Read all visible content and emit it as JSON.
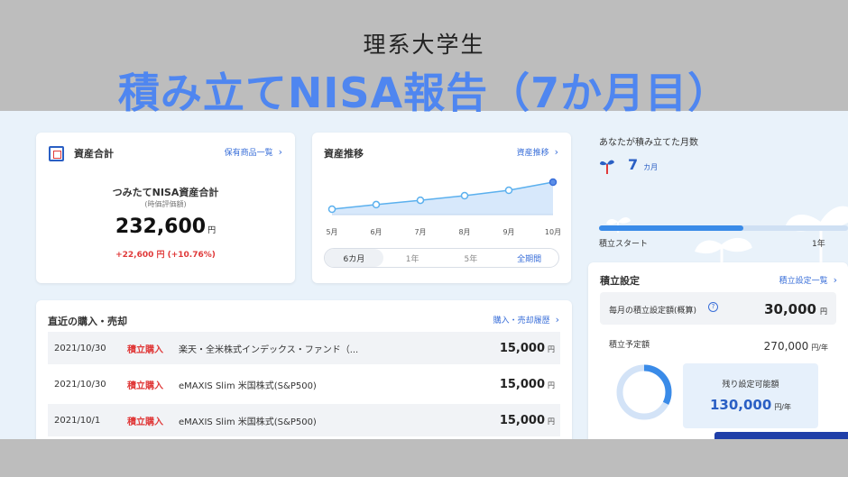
{
  "header": {
    "subtitle": "理系大学生",
    "title": "積み立てNISA報告（7か月目）"
  },
  "asset_card": {
    "title": "資産合計",
    "link": "保有商品一覧",
    "label": "つみたてNISA資産合計",
    "sublabel": "(時価評価額)",
    "amount": "232,600",
    "unit": "円",
    "gain": "+22,600 円 (+10.76%)"
  },
  "trend_card": {
    "title": "資産推移",
    "link": "資産推移",
    "ranges": [
      "6カ月",
      "1年",
      "5年",
      "全期間"
    ],
    "active_range": "6カ月"
  },
  "chart_data": {
    "type": "area",
    "categories": [
      "5月",
      "6月",
      "7月",
      "8月",
      "9月",
      "10月"
    ],
    "values": [
      0.0,
      0.17,
      0.33,
      0.5,
      0.7,
      1.0
    ]
  },
  "months_card": {
    "title": "あなたが積み立てた月数",
    "count": "7",
    "unit": "カ月",
    "start_label": "積立スタート",
    "end_label": "1年",
    "progress": 0.58
  },
  "purchases": {
    "title": "直近の購入・売却",
    "link": "購入・売却履歴",
    "rows": [
      {
        "date": "2021/10/30",
        "type": "積立購入",
        "name": "楽天・全米株式インデックス・ファンド（...",
        "amount": "15,000",
        "unit": "円"
      },
      {
        "date": "2021/10/30",
        "type": "積立購入",
        "name": "eMAXIS Slim 米国株式(S&P500)",
        "amount": "15,000",
        "unit": "円"
      },
      {
        "date": "2021/10/1",
        "type": "積立購入",
        "name": "eMAXIS Slim 米国株式(S&P500)",
        "amount": "15,000",
        "unit": "円"
      }
    ]
  },
  "settings": {
    "title": "積立設定",
    "link": "積立設定一覧",
    "monthly_label": "毎月の積立設定額(概算)",
    "monthly_amount": "30,000",
    "monthly_unit": "円",
    "planned_label": "積立予定額",
    "planned_amount": "270,000",
    "planned_unit": "円/年",
    "remaining_label": "残り設定可能額",
    "remaining_amount": "130,000",
    "remaining_unit": "円/年",
    "remaining_ratio": 0.675
  },
  "colors": {
    "accent": "#3a6fd9",
    "title_blue": "#4f86f0",
    "red": "#e03a3a",
    "app_bg": "#e9f2fa"
  }
}
